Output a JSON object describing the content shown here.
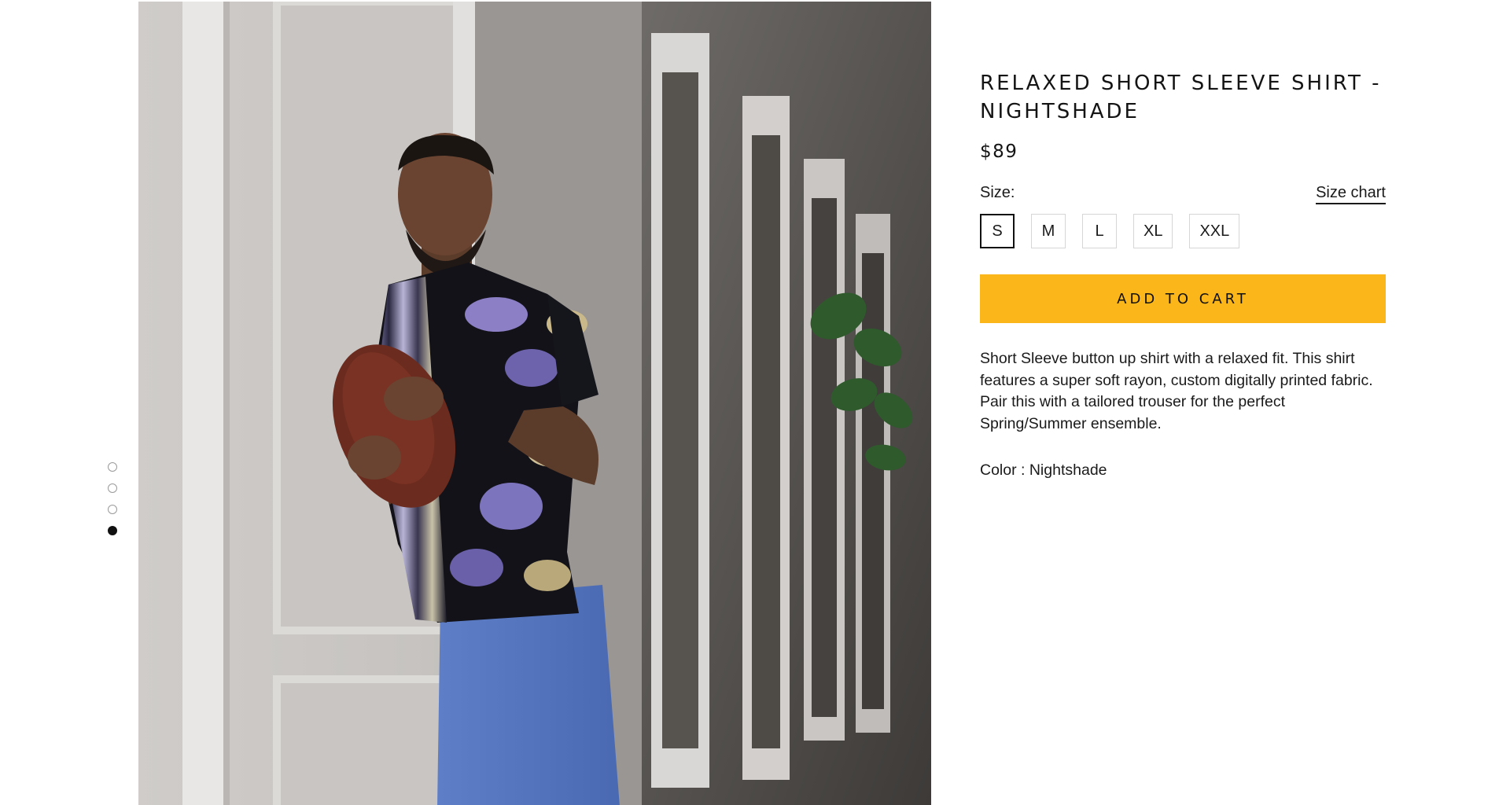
{
  "gallery": {
    "dots": [
      {
        "active": false
      },
      {
        "active": false
      },
      {
        "active": false
      },
      {
        "active": true
      }
    ]
  },
  "product": {
    "title": "RELAXED SHORT SLEEVE SHIRT - NIGHTSHADE",
    "price": "$89",
    "size_label": "Size:",
    "size_chart_label": "Size chart",
    "sizes": [
      "S",
      "M",
      "L",
      "XL",
      "XXL"
    ],
    "selected_size": "S",
    "add_to_cart_label": "ADD TO CART",
    "description": "Short Sleeve button up shirt with a relaxed fit. This shirt features a super soft rayon, custom digitally printed fabric. Pair this with a tailored trouser for the perfect Spring/Summer ensemble.",
    "color_text": "Color : Nightshade"
  },
  "colors": {
    "accent": "#fbb61a",
    "text": "#111111",
    "border": "#d6d6d6"
  },
  "icons": {
    "photo": "product-photo"
  }
}
